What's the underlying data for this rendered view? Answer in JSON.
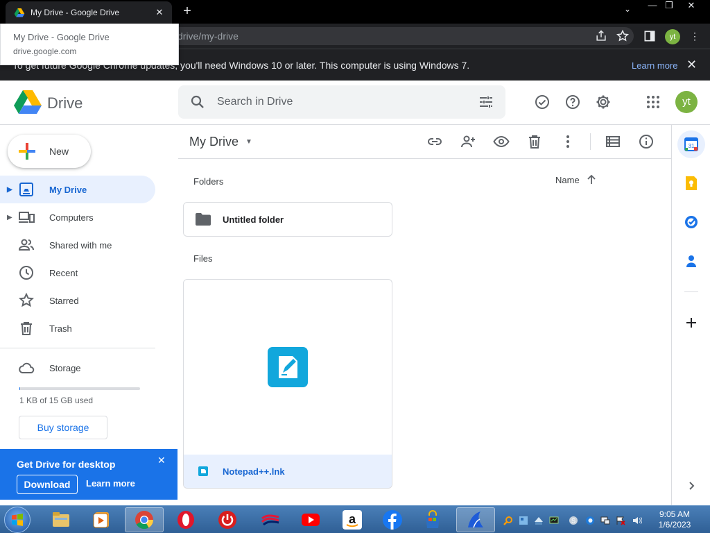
{
  "browser": {
    "tab_title": "My Drive - Google Drive",
    "tab_close": "✕",
    "new_tab": "+",
    "url_visible": "drive/my-drive",
    "tab_hover": {
      "title": "My Drive - Google Drive",
      "domain": "drive.google.com"
    },
    "profile_initials": "yt",
    "window_controls": [
      "—",
      "❐",
      "✕"
    ]
  },
  "infobar": {
    "message": "To get future Google Chrome updates, you'll need Windows 10 or later. This computer is using Windows 7.",
    "learn_more": "Learn more",
    "close": "✕"
  },
  "header": {
    "app_name": "Drive",
    "search_placeholder": "Search in Drive",
    "avatar_initials": "yt"
  },
  "sidebar": {
    "new_label": "New",
    "items": [
      {
        "label": "My Drive",
        "icon": "my-drive-icon",
        "active": true,
        "expandable": true
      },
      {
        "label": "Computers",
        "icon": "computers-icon",
        "active": false,
        "expandable": true
      },
      {
        "label": "Shared with me",
        "icon": "shared-icon",
        "active": false,
        "expandable": false
      },
      {
        "label": "Recent",
        "icon": "clock-icon",
        "active": false,
        "expandable": false
      },
      {
        "label": "Starred",
        "icon": "star-icon",
        "active": false,
        "expandable": false
      },
      {
        "label": "Trash",
        "icon": "trash-icon",
        "active": false,
        "expandable": false
      }
    ],
    "storage_label": "Storage",
    "storage_used_fraction": 0.001,
    "storage_text": "1 KB of 15 GB used",
    "buy_storage": "Buy storage"
  },
  "promo": {
    "title": "Get Drive for desktop",
    "download": "Download",
    "learn_more": "Learn more",
    "close": "✕"
  },
  "main": {
    "breadcrumb": "My Drive",
    "folders_label": "Folders",
    "files_label": "Files",
    "sort_label": "Name",
    "folders": [
      {
        "name": "Untitled folder"
      }
    ],
    "files": [
      {
        "name": "Notepad++.lnk"
      }
    ]
  },
  "taskbar": {
    "time": "9:05 AM",
    "date": "1/6/2023"
  },
  "colors": {
    "accent": "#1a73e8",
    "active_nav_bg": "#e8f0fe",
    "avatar": "#7cb342",
    "browser_dark": "#202124"
  }
}
